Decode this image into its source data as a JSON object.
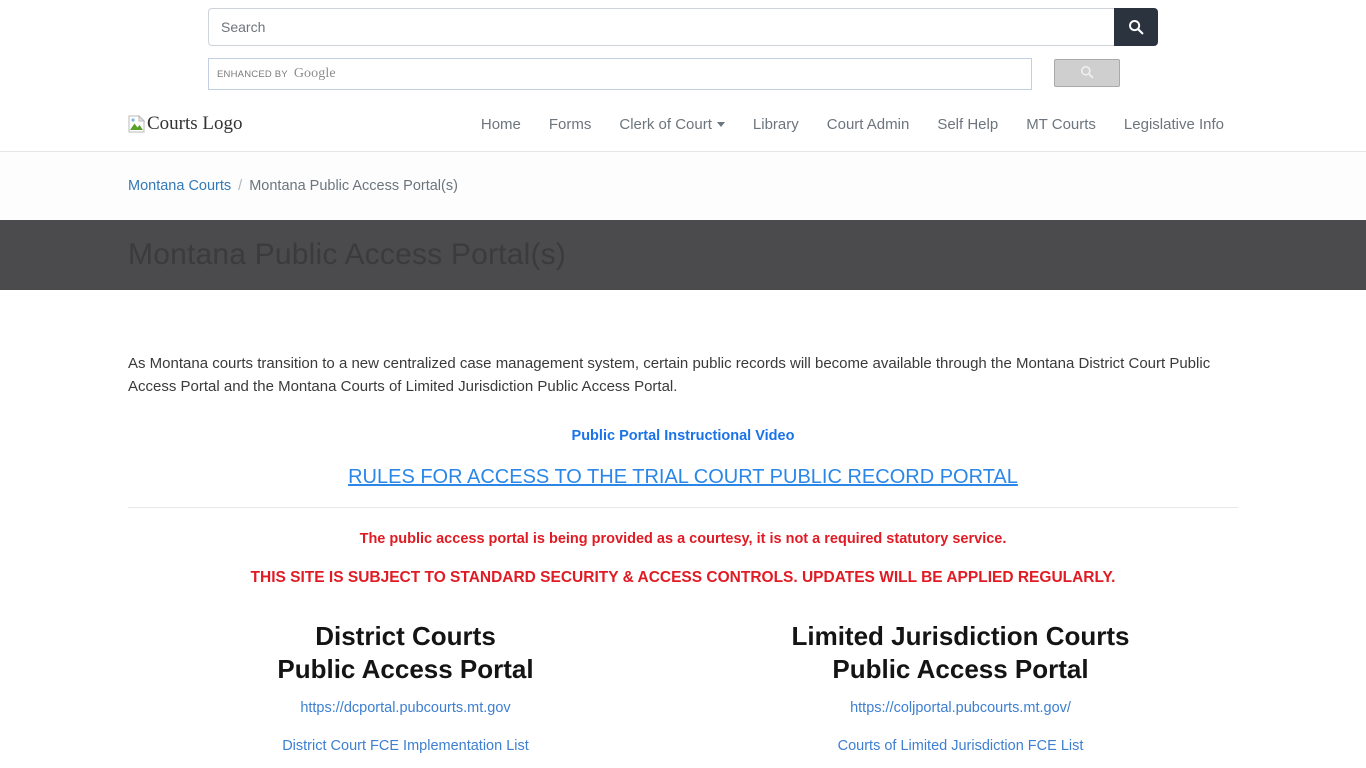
{
  "search": {
    "placeholder": "Search",
    "value": "",
    "submit_icon": "search-icon"
  },
  "google_cse": {
    "enhanced_label": "ENHANCED BY",
    "brand": "Google",
    "value": "",
    "button_icon": "search-icon"
  },
  "nav": {
    "logo_alt": "Courts Logo",
    "items": [
      {
        "label": "Home",
        "has_caret": false
      },
      {
        "label": "Forms",
        "has_caret": false
      },
      {
        "label": "Clerk of Court",
        "has_caret": true
      },
      {
        "label": "Library",
        "has_caret": false
      },
      {
        "label": "Court Admin",
        "has_caret": false
      },
      {
        "label": "Self Help",
        "has_caret": false
      },
      {
        "label": "MT Courts",
        "has_caret": false
      },
      {
        "label": "Legislative Info",
        "has_caret": false
      }
    ]
  },
  "breadcrumb": {
    "home": "Montana Courts",
    "separator": "/",
    "current": "Montana Public Access Portal(s)"
  },
  "page": {
    "title": "Montana Public Access Portal(s)",
    "banner_color": "#4b4b4d",
    "intro": "As Montana courts transition to a new centralized case management system, certain public records will become available through the Montana District Court Public Access Portal and the Montana Courts of Limited Jurisdiction Public Access Portal.",
    "video_link": "Public Portal Instructional Video",
    "rules_link": "RULES FOR ACCESS TO THE TRIAL COURT PUBLIC RECORD PORTAL",
    "notice_1": "The public access portal is being provided as a courtesy, it is not a required statutory service.",
    "notice_2": "THIS SITE IS SUBJECT TO STANDARD SECURITY & ACCESS CONTROLS.  UPDATES WILL BE APPLIED REGULARLY.",
    "notice_color": "#e01b24",
    "link_color": "#3d7fd0"
  },
  "portals": [
    {
      "heading_line1": "District Courts",
      "heading_line2": "Public Access Portal",
      "url": "https://dcportal.pubcourts.mt.gov",
      "fce_link": "District Court FCE Implementation List"
    },
    {
      "heading_line1": "Limited Jurisdiction Courts",
      "heading_line2": "Public Access Portal",
      "url": "https://coljportal.pubcourts.mt.gov/",
      "fce_link": "Courts of Limited Jurisdiction FCE List"
    }
  ]
}
